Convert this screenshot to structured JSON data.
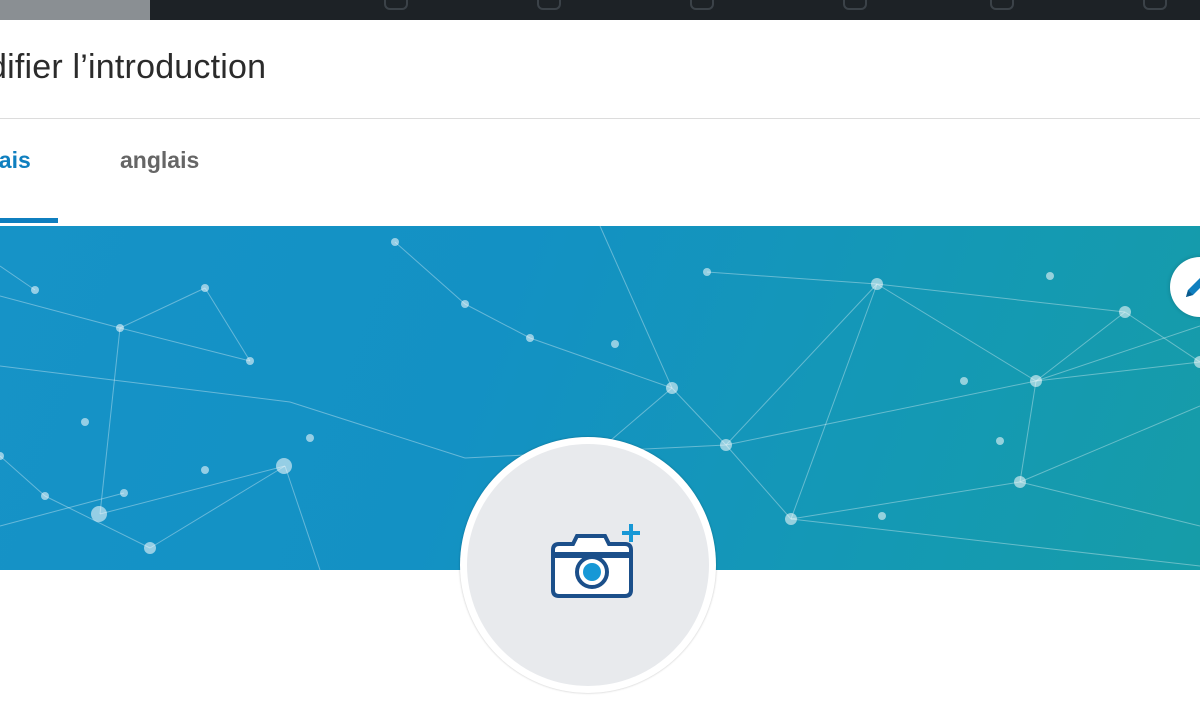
{
  "modal": {
    "title": "difier l’introduction"
  },
  "tabs": [
    {
      "label": "çais",
      "active": true
    },
    {
      "label": "anglais",
      "active": false
    }
  ],
  "banner": {
    "gradient_colors": [
      "#1693c7",
      "#169ca8"
    ]
  },
  "icons": {
    "edit": "pencil-icon",
    "photo": "camera-plus-icon"
  },
  "colors": {
    "accent": "#0f7fbf",
    "camera": "#1b4f8a",
    "avatar_bg": "#e8eaed"
  }
}
